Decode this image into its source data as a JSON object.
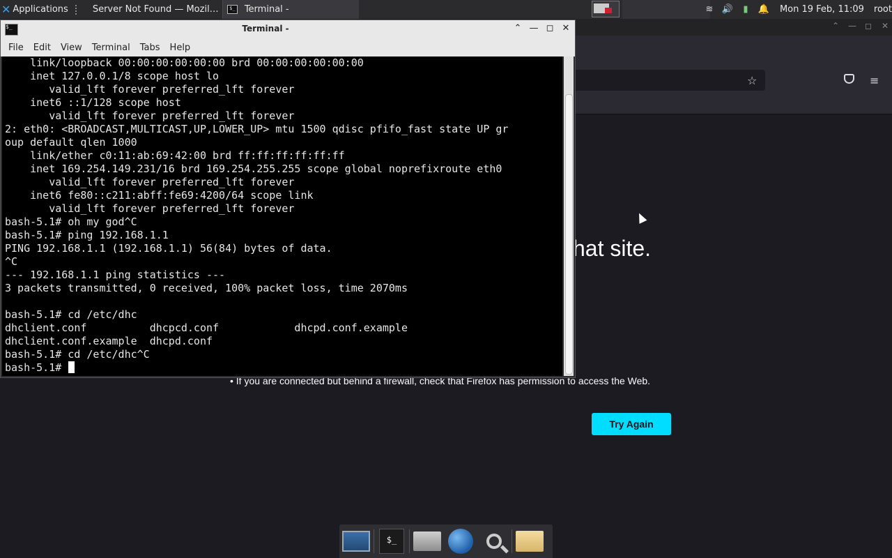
{
  "panel": {
    "app_menu_label": "Applications",
    "tasks": [
      {
        "label": "Server Not Found — Mozil…"
      },
      {
        "label": "Terminal -"
      }
    ],
    "clock": "Mon 19 Feb, 11:09",
    "user": "root"
  },
  "firefox": {
    "error_title_fragment": "hat site.",
    "bullet_text": "If you are connected but behind a firewall, check that Firefox has permission to access the Web.",
    "try_again_label": "Try Again"
  },
  "terminal": {
    "window_title": "Terminal -",
    "menu": [
      "File",
      "Edit",
      "View",
      "Terminal",
      "Tabs",
      "Help"
    ],
    "lines": [
      "    link/loopback 00:00:00:00:00:00 brd 00:00:00:00:00:00",
      "    inet 127.0.0.1/8 scope host lo",
      "       valid_lft forever preferred_lft forever",
      "    inet6 ::1/128 scope host",
      "       valid_lft forever preferred_lft forever",
      "2: eth0: <BROADCAST,MULTICAST,UP,LOWER_UP> mtu 1500 qdisc pfifo_fast state UP gr",
      "oup default qlen 1000",
      "    link/ether c0:11:ab:69:42:00 brd ff:ff:ff:ff:ff:ff",
      "    inet 169.254.149.231/16 brd 169.254.255.255 scope global noprefixroute eth0",
      "       valid_lft forever preferred_lft forever",
      "    inet6 fe80::c211:abff:fe69:4200/64 scope link",
      "       valid_lft forever preferred_lft forever",
      "bash-5.1# oh my god^C",
      "bash-5.1# ping 192.168.1.1",
      "PING 192.168.1.1 (192.168.1.1) 56(84) bytes of data.",
      "^C",
      "--- 192.168.1.1 ping statistics ---",
      "3 packets transmitted, 0 received, 100% packet loss, time 2070ms",
      "",
      "bash-5.1# cd /etc/dhc",
      "dhclient.conf          dhcpcd.conf            dhcpd.conf.example",
      "dhclient.conf.example  dhcpd.conf",
      "bash-5.1# cd /etc/dhc^C"
    ],
    "prompt": "bash-5.1# "
  },
  "dock": {
    "items": [
      "show-desktop",
      "terminal",
      "home-folder",
      "web-browser",
      "app-finder",
      "file-manager"
    ]
  }
}
